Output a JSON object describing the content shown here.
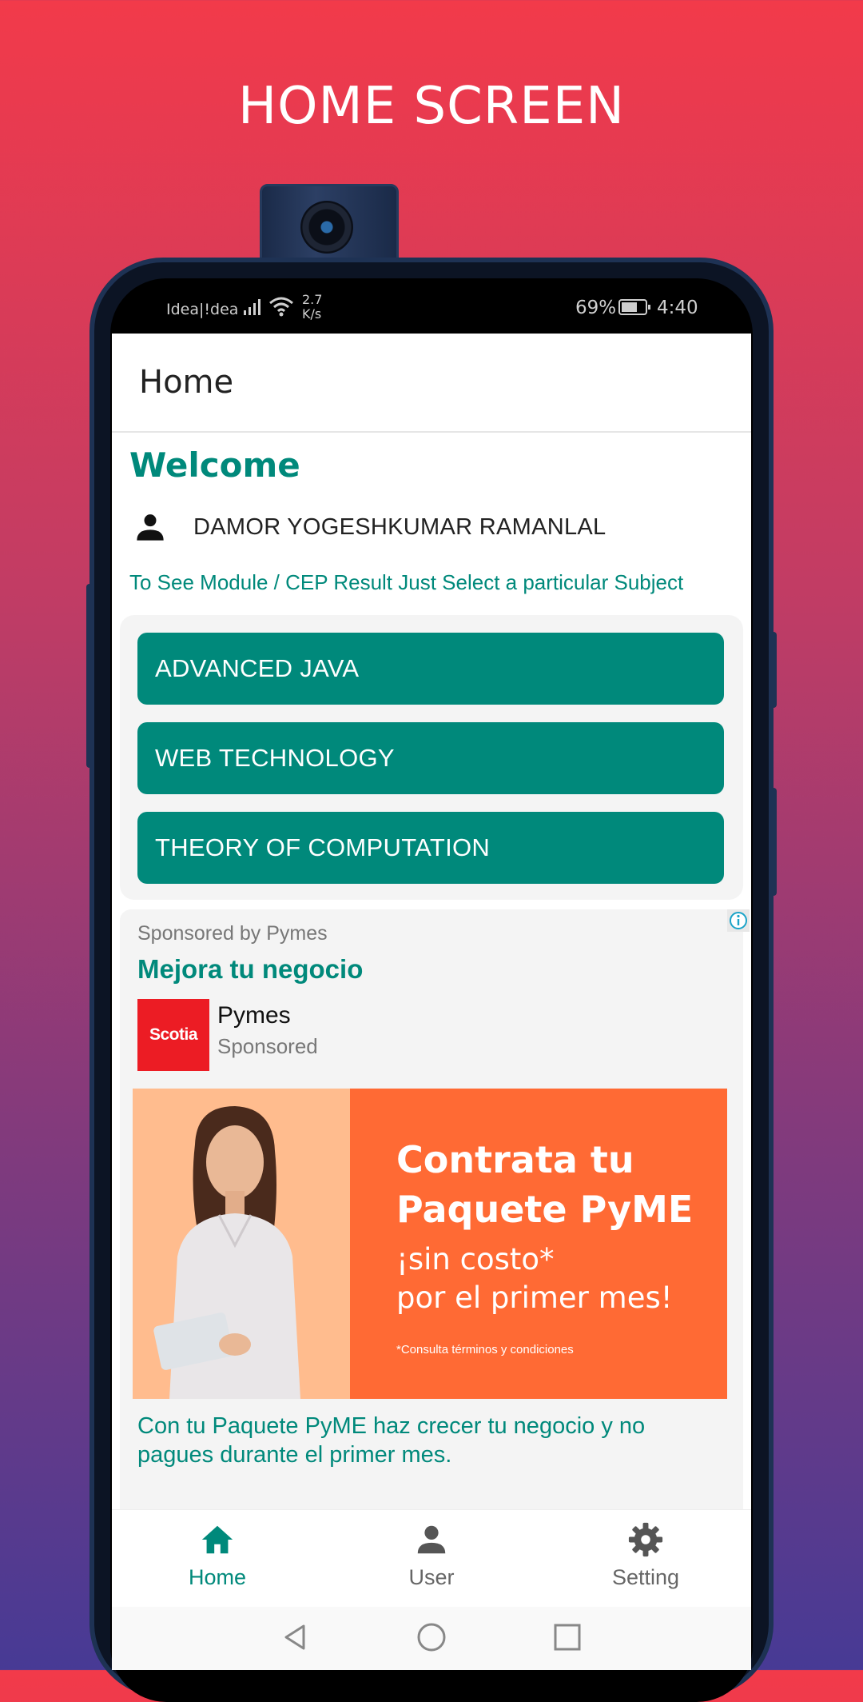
{
  "headline": "HOME SCREEN",
  "status": {
    "carrier": "Idea|!dea",
    "speed_value": "2.7",
    "speed_unit": "K/s",
    "battery_pct": "69%",
    "battery_level": 0.69,
    "time": "4:40"
  },
  "appbar": {
    "title": "Home"
  },
  "welcome": "Welcome",
  "user_name": "DAMOR YOGESHKUMAR RAMANLAL",
  "hint": "To See Module / CEP Result Just Select a particular Subject",
  "subjects": [
    "ADVANCED JAVA",
    "WEB TECHNOLOGY",
    "THEORY OF COMPUTATION"
  ],
  "ad": {
    "sponsor_line": "Sponsored by Pymes",
    "headline": "Mejora tu negocio",
    "logo_text": "Scotia",
    "brand": "Pymes",
    "sponsored": "Sponsored",
    "banner": {
      "line1": "Contrata tu",
      "line2": "Paquete PyME",
      "line3": "¡sin costo*",
      "line4": "por el primer mes!",
      "terms": "*Consulta términos y condiciones"
    },
    "body": "Con tu Paquete PyME haz crecer tu negocio y no pagues durante el primer mes."
  },
  "nav": {
    "home": "Home",
    "user": "User",
    "setting": "Setting"
  },
  "colors": {
    "accent": "#00897b",
    "ad_orange": "#ff6a34",
    "scotia_red": "#ec1c24"
  }
}
